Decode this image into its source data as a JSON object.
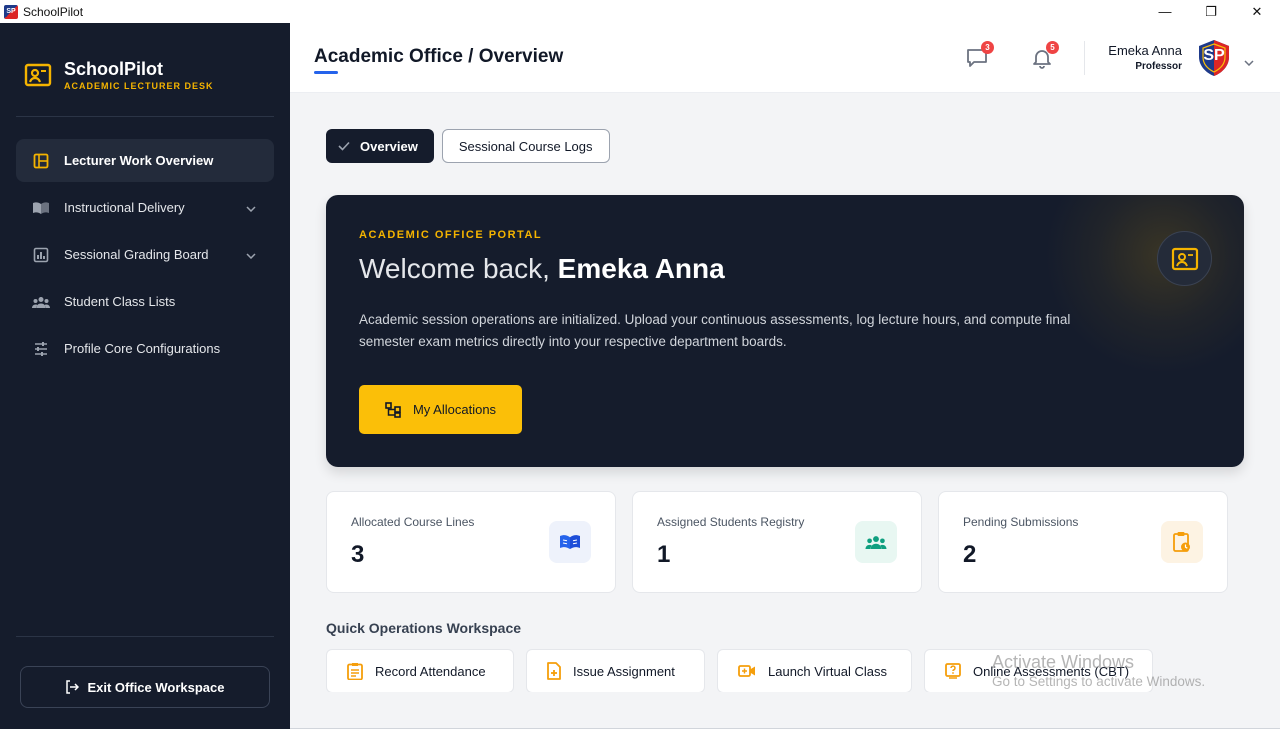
{
  "window": {
    "title": "SchoolPilot",
    "app_icon_text": "SP",
    "minimize": "—",
    "maximize": "❐",
    "close": "✕"
  },
  "brand": {
    "name": "SchoolPilot",
    "subtitle": "ACADEMIC LECTURER DESK"
  },
  "sidebar": {
    "items": [
      {
        "label": "Lecturer Work Overview",
        "icon": "layout-icon",
        "active": true
      },
      {
        "label": "Instructional Delivery",
        "icon": "book-open-icon",
        "expandable": true
      },
      {
        "label": "Sessional Grading Board",
        "icon": "chart-icon",
        "expandable": true
      },
      {
        "label": "Student Class Lists",
        "icon": "users-icon"
      },
      {
        "label": "Profile Core Configurations",
        "icon": "sliders-icon"
      }
    ],
    "exit_label": "Exit Office Workspace"
  },
  "header": {
    "title": "Academic Office / Overview",
    "messages_count": "3",
    "notifications_count": "5",
    "user_name": "Emeka Anna",
    "user_role": "Professor",
    "avatar_text": "SP"
  },
  "tabs": [
    {
      "label": "Overview",
      "active": true
    },
    {
      "label": "Sessional Course Logs",
      "active": false
    }
  ],
  "hero": {
    "kicker": "ACADEMIC OFFICE PORTAL",
    "greeting": "Welcome back, ",
    "name": "Emeka Anna",
    "description": "Academic session operations are initialized. Upload your continuous assessments, log lecture hours, and compute final semester exam metrics directly into your respective department boards.",
    "button_label": "My Allocations"
  },
  "stats": [
    {
      "label": "Allocated Course Lines",
      "value": "3",
      "icon": "book-open-icon",
      "color": "#2563eb",
      "bg": "#eef2fb"
    },
    {
      "label": "Assigned Students Registry",
      "value": "1",
      "icon": "users-icon",
      "color": "#0f9f7f",
      "bg": "#e8f7f2"
    },
    {
      "label": "Pending Submissions",
      "value": "2",
      "icon": "clipboard-clock-icon",
      "color": "#f59e0b",
      "bg": "#fdf3e3"
    }
  ],
  "quick": {
    "title": "Quick Operations Workspace",
    "actions": [
      {
        "label": "Record Attendance",
        "icon": "clipboard-list-icon"
      },
      {
        "label": "Issue Assignment",
        "icon": "file-plus-icon"
      },
      {
        "label": "Launch Virtual Class",
        "icon": "video-icon"
      },
      {
        "label": "Online Assessments (CBT)",
        "icon": "quiz-icon"
      }
    ]
  },
  "watermark": {
    "title": "Activate Windows",
    "subtitle": "Go to Settings to activate Windows."
  },
  "colors": {
    "sidebar_bg": "#151c2c",
    "accent": "#fbbf08",
    "link_blue": "#2563eb",
    "badge_red": "#ef4444"
  }
}
